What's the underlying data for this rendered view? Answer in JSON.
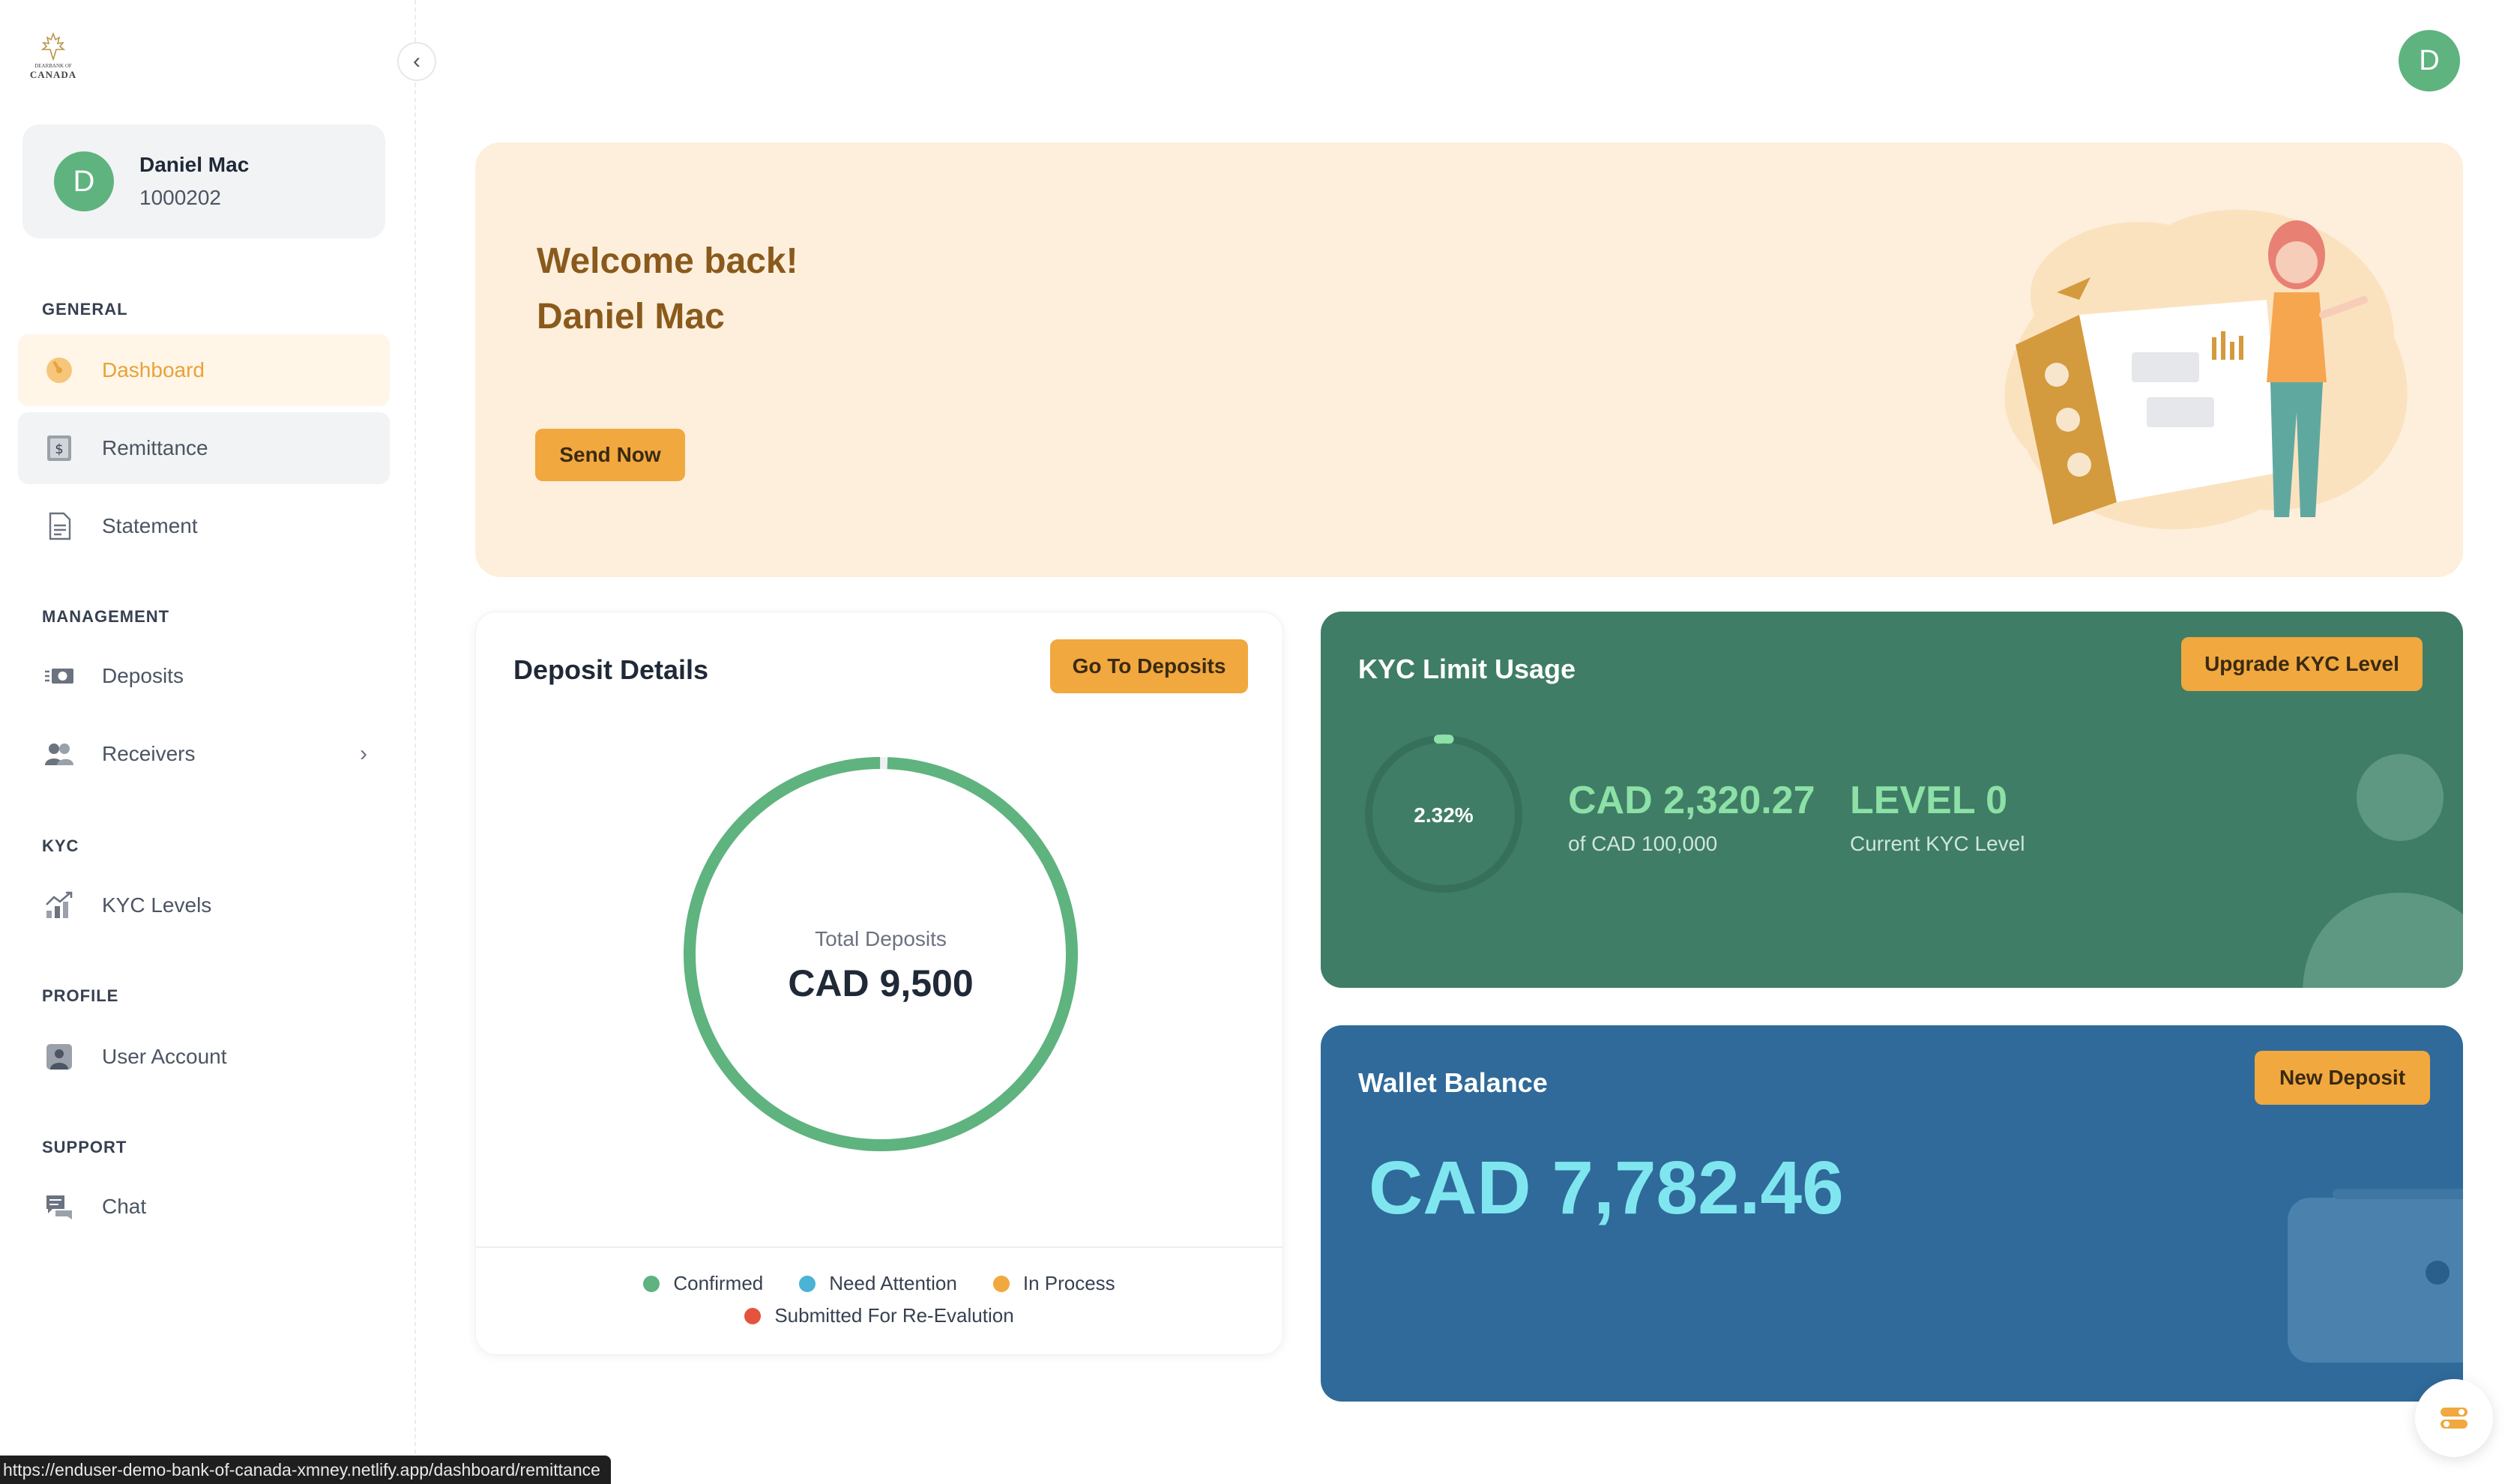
{
  "brand": {
    "logo_line1": "DEARBANK OF",
    "logo_line2": "CANADA"
  },
  "user": {
    "initial": "D",
    "name": "Daniel Mac",
    "id": "1000202"
  },
  "sidebar": {
    "collapse_glyph": "‹",
    "sections": {
      "general": "GENERAL",
      "management": "MANAGEMENT",
      "kyc": "KYC",
      "profile": "PROFILE",
      "support": "SUPPORT"
    },
    "items": {
      "dashboard": "Dashboard",
      "remittance": "Remittance",
      "statement": "Statement",
      "deposits": "Deposits",
      "receivers": "Receivers",
      "kyc_levels": "KYC Levels",
      "user_account": "User Account",
      "chat": "Chat"
    },
    "chevron": "›"
  },
  "welcome": {
    "line1": "Welcome back!",
    "line2": "Daniel Mac",
    "button": "Send Now"
  },
  "deposit": {
    "title": "Deposit Details",
    "button": "Go To Deposits",
    "center_label": "Total Deposits",
    "center_value": "CAD 9,500",
    "legend": [
      {
        "label": "Confirmed",
        "color": "#5fb37e"
      },
      {
        "label": "Need Attention",
        "color": "#4ab3d6"
      },
      {
        "label": "In Process",
        "color": "#f1a83e"
      },
      {
        "label": "Submitted For Re-Evalution",
        "color": "#e5533d"
      }
    ],
    "confirmed_fraction": 1.0
  },
  "kyc": {
    "title": "KYC Limit Usage",
    "button": "Upgrade KYC Level",
    "percent": "2.32%",
    "percent_value": 2.32,
    "amount": "CAD 2,320.27",
    "limit": "of CAD 100,000",
    "level": "LEVEL 0",
    "level_label": "Current KYC Level"
  },
  "wallet": {
    "title": "Wallet Balance",
    "button": "New Deposit",
    "amount": "CAD 7,782.46"
  },
  "status_bar": {
    "url": "https://enduser-demo-bank-of-canada-xmney.netlify.app/dashboard/remittance"
  },
  "colors": {
    "accent": "#f1a83e",
    "kyc_bg": "#3f7d66",
    "wallet_bg": "#2f6a9a",
    "banner_bg": "#fdefdc"
  }
}
